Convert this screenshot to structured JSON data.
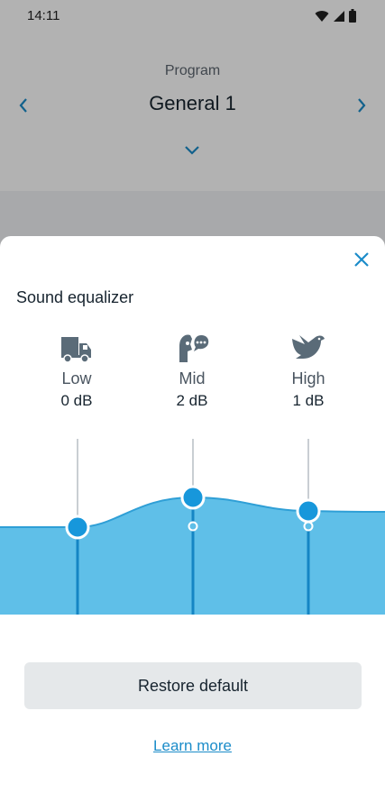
{
  "status_bar": {
    "time": "14:11"
  },
  "program": {
    "label": "Program",
    "name": "General 1"
  },
  "sheet": {
    "title": "Sound equalizer",
    "bands": [
      {
        "name": "Low",
        "value": "0 dB",
        "icon": "truck-icon",
        "gain_db": 0
      },
      {
        "name": "Mid",
        "value": "2 dB",
        "icon": "speaking-person-icon",
        "gain_db": 2
      },
      {
        "name": "High",
        "value": "1 dB",
        "icon": "bird-icon",
        "gain_db": 1
      }
    ],
    "restore_label": "Restore default",
    "learn_more_label": "Learn more"
  },
  "colors": {
    "accent": "#1b8cc9",
    "fill": "#5fbfe8",
    "thumb": "#1797db",
    "scrim": "rgba(0,0,0,0.30)",
    "button_bg": "#e5e8ea"
  }
}
